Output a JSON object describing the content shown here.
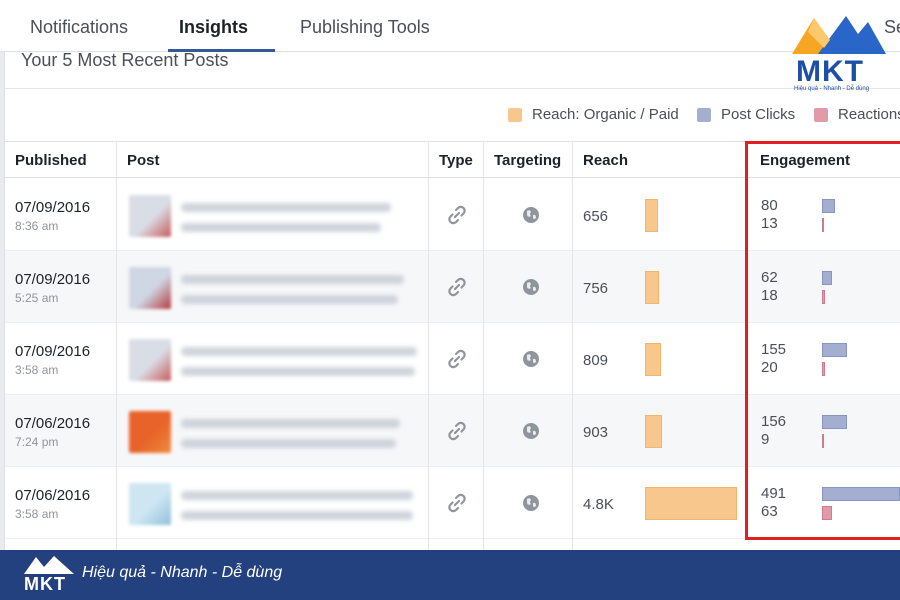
{
  "tabs": {
    "notifications": "Notifications",
    "insights": "Insights",
    "publishing_tools": "Publishing Tools",
    "settings_partial": "Se"
  },
  "section_title": "Your 5 Most Recent Posts",
  "legend": {
    "reach": "Reach: Organic / Paid",
    "clicks": "Post Clicks",
    "reactions": "Reactions"
  },
  "columns": {
    "published": "Published",
    "post": "Post",
    "type": "Type",
    "targeting": "Targeting",
    "reach": "Reach",
    "engagement": "Engagement"
  },
  "rows": [
    {
      "date": "07/09/2016",
      "time": "8:36 am",
      "reach": "656",
      "reach_value": 656,
      "clicks": "80",
      "clicks_value": 80,
      "reactions": "13",
      "reactions_value": 13
    },
    {
      "date": "07/09/2016",
      "time": "5:25 am",
      "reach": "756",
      "reach_value": 756,
      "clicks": "62",
      "clicks_value": 62,
      "reactions": "18",
      "reactions_value": 18
    },
    {
      "date": "07/09/2016",
      "time": "3:58 am",
      "reach": "809",
      "reach_value": 809,
      "clicks": "155",
      "clicks_value": 155,
      "reactions": "20",
      "reactions_value": 20
    },
    {
      "date": "07/06/2016",
      "time": "7:24 pm",
      "reach": "903",
      "reach_value": 903,
      "clicks": "156",
      "clicks_value": 156,
      "reactions": "9",
      "reactions_value": 9
    },
    {
      "date": "07/06/2016",
      "time": "3:58 am",
      "reach": "4.8K",
      "reach_value": 4800,
      "clicks": "491",
      "clicks_value": 491,
      "reactions": "63",
      "reactions_value": 63
    }
  ],
  "icons": {
    "type": "link-icon",
    "targeting": "globe-icon"
  },
  "colors": {
    "reach": "#f7c78d",
    "clicks": "#a3aed0",
    "reactions": "#e09aa8",
    "highlight": "#e02020",
    "banner": "#23417f"
  },
  "brand": {
    "name": "MKT",
    "tagline_small": "Hiệu quả - Nhanh - Dễ dùng",
    "banner_tagline": "Hiệu quả - Nhanh  - Dễ dùng"
  }
}
